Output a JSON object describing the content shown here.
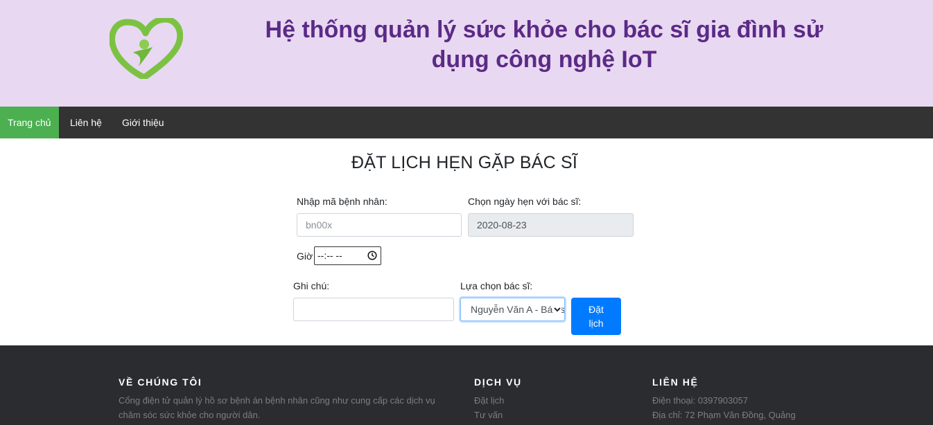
{
  "header": {
    "logo_icon": "heart-person-logo",
    "title": "Hệ thống quản lý sức khỏe cho bác sĩ gia đình sử dụng công nghệ IoT",
    "bg_color": "#e8d8f2",
    "title_color": "#5b2a86"
  },
  "nav": {
    "items": [
      {
        "label": "Trang chủ",
        "active": true
      },
      {
        "label": "Liên hệ"
      },
      {
        "label": "Giới thiệu"
      }
    ],
    "bg_color": "#333333",
    "active_color": "#4caf50"
  },
  "form": {
    "title": "ĐẶT LỊCH HẸN GẶP BÁC SĨ",
    "patient_label": "Nhập mã bệnh nhân:",
    "patient_placeholder": "bn00x",
    "date_label": "Chọn ngày hẹn với bác sĩ:",
    "date_value": "2020-08-23",
    "time_label": "Giờ",
    "time_value": "--:-- --",
    "note_label": "Ghi chú:",
    "note_value": "",
    "doctor_label": "Lựa chọn bác sĩ:",
    "doctor_selected": "Nguyễn Văn A - Bác sĩ",
    "submit_label_line1": "Đặt",
    "submit_label_line2": "lịch",
    "button_color": "#007bff"
  },
  "footer": {
    "about": {
      "heading": "VỀ CHÚNG TÔI",
      "text_line1": "Cổng điện tử quản lý hồ sơ bệnh án bệnh nhân cũng như cung cấp các dịch vụ",
      "text_line2": "chăm sóc sức khỏe cho người dân."
    },
    "services": {
      "heading": "DỊCH VỤ",
      "items": [
        "Đặt lịch",
        "Tư vấn"
      ]
    },
    "contact": {
      "heading": "LIÊN HỆ",
      "phone": "Điện thoại: 0397903057",
      "address": "Địa chỉ: 72 Phạm Văn Đồng, Quảng"
    },
    "bg_color": "#2b2c30"
  }
}
